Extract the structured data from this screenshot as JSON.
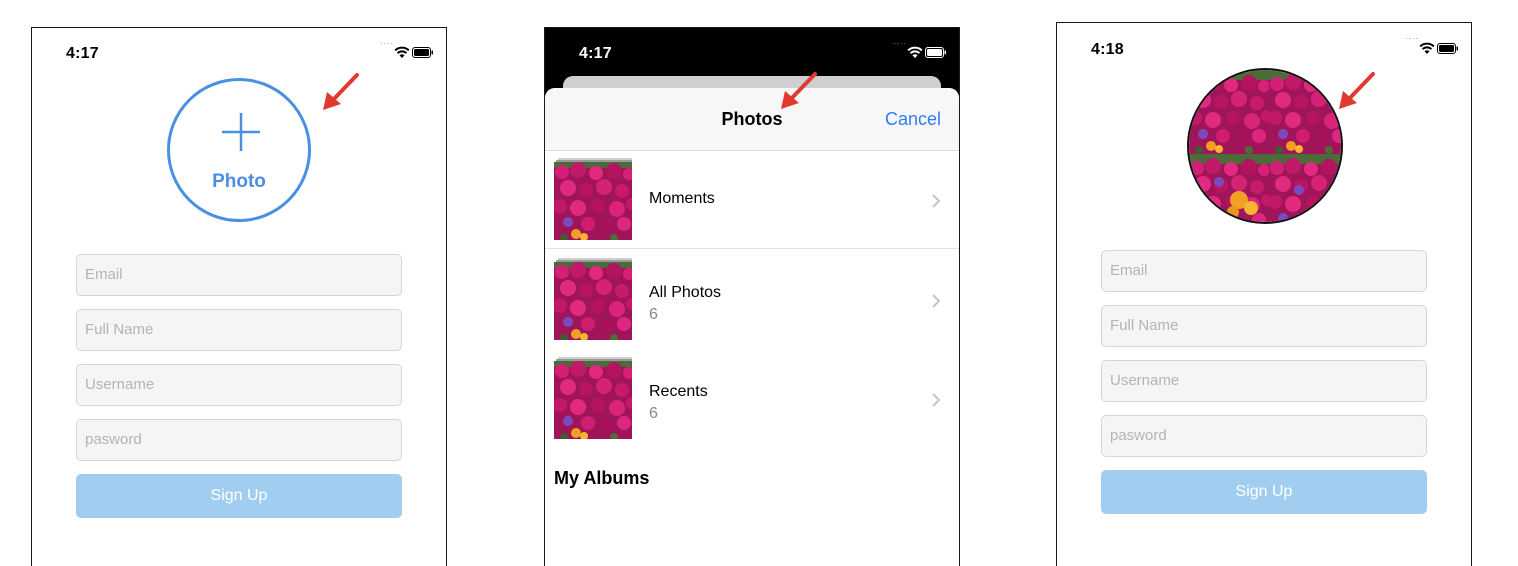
{
  "screens": {
    "signup_empty": {
      "status_time": "4:17",
      "photo_label": "Photo",
      "fields": [
        "Email",
        "Full Name",
        "Username",
        "pasword"
      ],
      "signup_label": "Sign Up"
    },
    "picker": {
      "status_time": "4:17",
      "title": "Photos",
      "cancel_label": "Cancel",
      "albums": [
        {
          "name": "Moments",
          "count": ""
        },
        {
          "name": "All Photos",
          "count": "6"
        },
        {
          "name": "Recents",
          "count": "6"
        }
      ],
      "section_title": "My Albums"
    },
    "signup_selected": {
      "status_time": "4:18",
      "fields": [
        "Email",
        "Full Name",
        "Username",
        "pasword"
      ],
      "signup_label": "Sign Up"
    }
  },
  "icons": {
    "plus": "plus-icon",
    "chevron": "chevron-right-icon",
    "arrow": "annotation-arrow-icon",
    "wifi": "wifi-icon",
    "battery": "battery-icon"
  },
  "colors": {
    "accent": "#4a90e2",
    "signup_button": "#a1cdf1",
    "annotation_arrow": "#e03a2f",
    "cancel_link": "#2f7cf6"
  }
}
